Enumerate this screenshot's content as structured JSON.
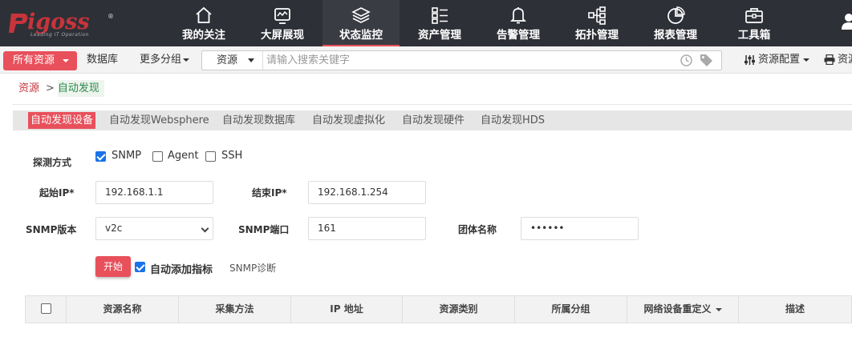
{
  "logo": {
    "text": "igoss",
    "reg": "®",
    "tagline": "Leading IT Operation"
  },
  "nav": {
    "items": [
      {
        "label": "我的关注",
        "icon": "home-icon"
      },
      {
        "label": "大屏展现",
        "icon": "monitor-icon"
      },
      {
        "label": "状态监控",
        "icon": "layers-icon",
        "active": true
      },
      {
        "label": "资产管理",
        "icon": "list-icon"
      },
      {
        "label": "告警管理",
        "icon": "bell-icon"
      },
      {
        "label": "拓扑管理",
        "icon": "topology-icon"
      },
      {
        "label": "报表管理",
        "icon": "pie-chart-icon"
      },
      {
        "label": "工具箱",
        "icon": "toolbox-icon"
      }
    ]
  },
  "toolbar": {
    "all_resources": "所有资源",
    "database": "数据库",
    "more_groups": "更多分组",
    "search_scope": "资源",
    "search_placeholder": "请输入搜索关键字",
    "resource_config": "资源配置",
    "resource_cut": "资源"
  },
  "breadcrumb": {
    "root": "资源",
    "sep": ">",
    "current": "自动发现"
  },
  "subtabs": [
    "自动发现设备",
    "自动发现Websphere",
    "自动发现数据库",
    "自动发现虚拟化",
    "自动发现硬件",
    "自动发现HDS"
  ],
  "form": {
    "probe_label": "探测方式",
    "probe_options": [
      {
        "label": "SNMP",
        "checked": true
      },
      {
        "label": "Agent",
        "checked": false
      },
      {
        "label": "SSH",
        "checked": false
      }
    ],
    "start_ip_label": "起始IP*",
    "start_ip": "192.168.1.1",
    "end_ip_label": "结束IP*",
    "end_ip": "192.168.1.254",
    "snmp_version_label": "SNMP版本",
    "snmp_version": "v2c",
    "snmp_port_label": "SNMP端口",
    "snmp_port": "161",
    "community_label": "团体名称",
    "community": "••••••",
    "start_button": "开始",
    "auto_add_label": "自动添加指标",
    "auto_add_checked": true,
    "snmp_diag": "SNMP诊断"
  },
  "table": {
    "columns": [
      "资源名称",
      "采集方法",
      "IP 地址",
      "资源类别",
      "所属分组",
      "网络设备重定义",
      "描述"
    ]
  },
  "colors": {
    "accent": "#e8505b",
    "nav_bg": "#2e3037",
    "checkbox": "#1a73e8"
  }
}
